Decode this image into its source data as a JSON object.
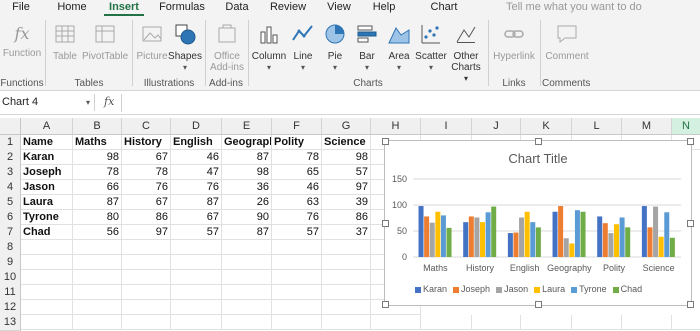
{
  "tabs": [
    "File",
    "Home",
    "Insert",
    "Formulas",
    "Data",
    "Review",
    "View",
    "Help",
    "Chart"
  ],
  "active_tab": "Insert",
  "tell_me": "Tell me what you want to do",
  "ribbon": {
    "function": "Function",
    "table": "Table",
    "pivottable": "PivotTable",
    "picture": "Picture",
    "shapes": "Shapes",
    "office_addins_1": "Office",
    "office_addins_2": "Add-ins",
    "column": "Column",
    "line": "Line",
    "pie": "Pie",
    "bar": "Bar",
    "area": "Area",
    "scatter": "Scatter",
    "other_charts_1": "Other",
    "other_charts_2": "Charts",
    "hyperlink": "Hyperlink",
    "comment": "Comment",
    "groups": {
      "functions": "Functions",
      "tables": "Tables",
      "illustrations": "Illustrations",
      "addins": "Add-ins",
      "charts": "Charts",
      "links": "Links",
      "comments": "Comments"
    }
  },
  "formula_bar": {
    "name_box": "Chart 4",
    "fx": "fx",
    "value": ""
  },
  "columns": [
    "A",
    "B",
    "C",
    "D",
    "E",
    "F",
    "G",
    "H",
    "I",
    "J",
    "K",
    "L",
    "M",
    "N"
  ],
  "rows": [
    "1",
    "2",
    "3",
    "4",
    "5",
    "6",
    "7",
    "8",
    "9",
    "10",
    "11",
    "12",
    "13"
  ],
  "sheet": {
    "header": [
      "Name",
      "Maths",
      "History",
      "English",
      "Geography",
      "Polity",
      "Science"
    ],
    "data": [
      {
        "name": "Karan",
        "values": [
          98,
          67,
          46,
          87,
          78,
          98
        ]
      },
      {
        "name": "Joseph",
        "values": [
          78,
          78,
          47,
          98,
          65,
          57
        ]
      },
      {
        "name": "Jason",
        "values": [
          66,
          76,
          76,
          36,
          46,
          97
        ]
      },
      {
        "name": "Laura",
        "values": [
          87,
          67,
          87,
          26,
          63,
          39
        ]
      },
      {
        "name": "Tyrone",
        "values": [
          80,
          86,
          67,
          90,
          76,
          86
        ]
      },
      {
        "name": "Chad",
        "values": [
          56,
          97,
          57,
          87,
          57,
          37
        ]
      }
    ]
  },
  "colors": {
    "accent": "#217346",
    "series": [
      "#4472C4",
      "#ED7D31",
      "#A5A5A5",
      "#FFC000",
      "#5B9BD5",
      "#70AD47"
    ]
  },
  "chart_data": {
    "type": "bar",
    "title": "Chart Title",
    "categories": [
      "Maths",
      "History",
      "English",
      "Geography",
      "Polity",
      "Science"
    ],
    "series": [
      {
        "name": "Karan",
        "values": [
          98,
          67,
          46,
          87,
          78,
          98
        ]
      },
      {
        "name": "Joseph",
        "values": [
          78,
          78,
          47,
          98,
          65,
          57
        ]
      },
      {
        "name": "Jason",
        "values": [
          66,
          76,
          76,
          36,
          46,
          97
        ]
      },
      {
        "name": "Laura",
        "values": [
          87,
          67,
          87,
          26,
          63,
          39
        ]
      },
      {
        "name": "Tyrone",
        "values": [
          80,
          86,
          67,
          90,
          76,
          86
        ]
      },
      {
        "name": "Chad",
        "values": [
          56,
          97,
          57,
          87,
          57,
          37
        ]
      }
    ],
    "ylim": [
      0,
      150
    ],
    "yticks": [
      0,
      50,
      100,
      150
    ],
    "grid": true,
    "legend": "bottom"
  }
}
